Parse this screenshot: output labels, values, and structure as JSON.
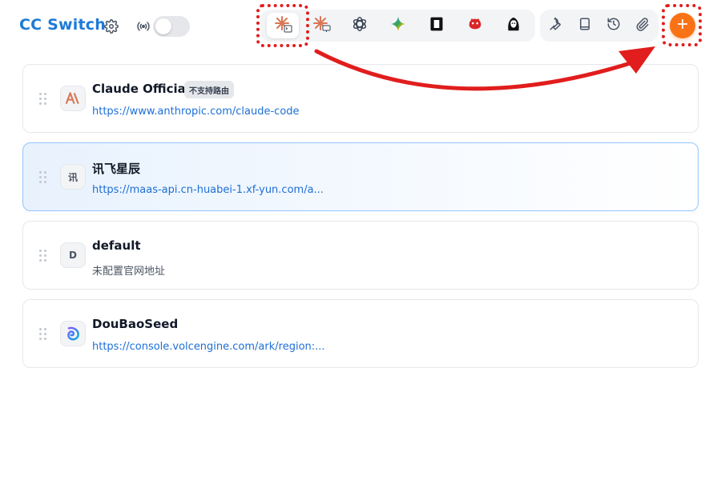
{
  "app": {
    "title": "CC Switch"
  },
  "header": {
    "settings_icon": "gear-icon",
    "proxy_icon": "radio-signal-icon",
    "proxy_toggle_on": false,
    "apps": [
      {
        "name": "claude-code",
        "icon": "claude-code-icon",
        "active": true
      },
      {
        "name": "claude-desktop",
        "icon": "claude-desktop-icon",
        "active": false
      },
      {
        "name": "openai",
        "icon": "openai-icon",
        "active": false
      },
      {
        "name": "gemini",
        "icon": "gemini-sparkle-icon",
        "active": false
      },
      {
        "name": "black-square-app",
        "icon": "square-app-icon",
        "active": false
      },
      {
        "name": "red-app",
        "icon": "red-mascot-icon",
        "active": false
      },
      {
        "name": "bw-app",
        "icon": "bw-character-icon",
        "active": false
      }
    ],
    "tools": [
      {
        "name": "tools",
        "icon": "wrench-icon"
      },
      {
        "name": "docs",
        "icon": "book-icon"
      },
      {
        "name": "history",
        "icon": "history-icon"
      },
      {
        "name": "skills",
        "icon": "paperclip-icon"
      }
    ],
    "add_icon": "plus-icon"
  },
  "colors": {
    "brand": "#1e7bd6",
    "accent": "#f97316",
    "link": "#1d6fd6",
    "annotation": "#e11d1d",
    "selected_border": "#93c5fd"
  },
  "providers": [
    {
      "name": "Claude Official",
      "badge": "不支持路由",
      "url": "https://www.anthropic.com/claude-code",
      "icon_text": "AI",
      "selected": false
    },
    {
      "name": "讯飞星辰",
      "badge": "",
      "url": "https://maas-api.cn-huabei-1.xf-yun.com/a...",
      "icon_text": "讯",
      "selected": true
    },
    {
      "name": "default",
      "badge": "",
      "url": "未配置官网地址",
      "icon_text": "D",
      "selected": false
    },
    {
      "name": "DouBaoSeed",
      "badge": "",
      "url": "https://console.volcengine.com/ark/region:...",
      "icon_text": "",
      "selected": false
    }
  ]
}
